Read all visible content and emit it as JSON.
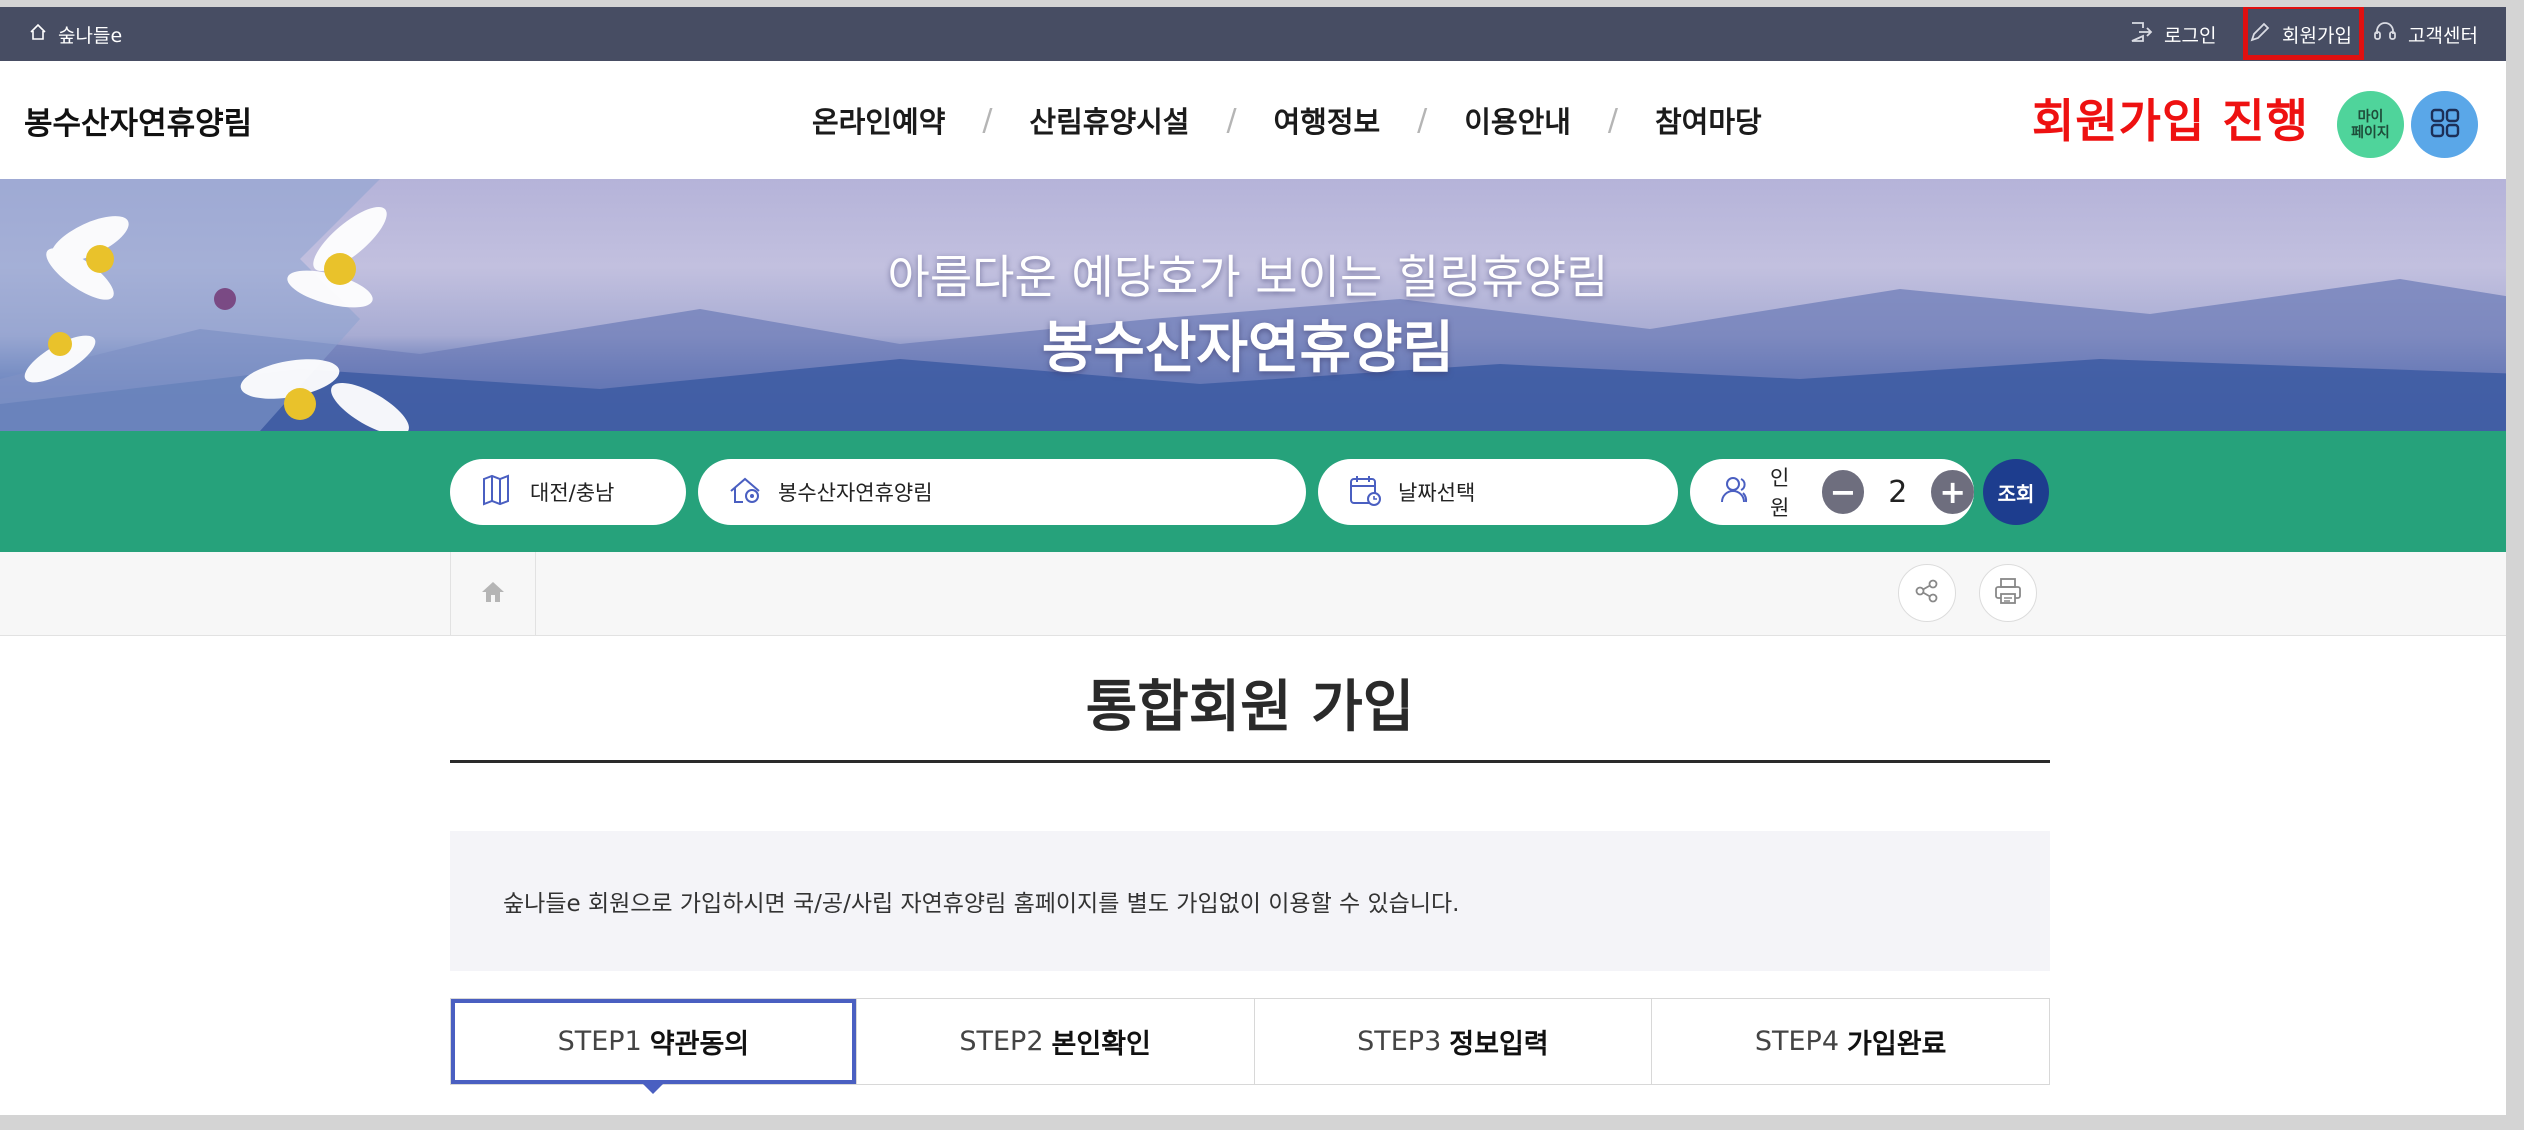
{
  "util": {
    "home_label": "숲나들e",
    "login_label": "로그인",
    "join_label": "회원가입",
    "cs_label": "고객센터"
  },
  "header": {
    "brand": "봉수산자연휴양림",
    "nav": [
      "온라인예약",
      "산림휴양시설",
      "여행정보",
      "이용안내",
      "참여마당"
    ],
    "nav_separator": "/",
    "join_caption": "회원가입 진행",
    "mypage_label_1": "마이",
    "mypage_label_2": "페이지"
  },
  "hero": {
    "title_line1": "아름다운 예당호가 보이는 힐링휴양림",
    "title_line2": "봉수산자연휴양림"
  },
  "search": {
    "region": "대전/충남",
    "forest": "봉수산자연휴양림",
    "date": "날짜선택",
    "people_label": "인원",
    "people_count": "2",
    "minus": "−",
    "plus": "+",
    "search_label": "조회"
  },
  "main": {
    "title": "통합회원 가입",
    "notice": "숲나들e 회원으로 가입하시면 국/공/사립 자연휴양림 홈페이지를 별도 가입없이 이용할 수 있습니다.",
    "steps": [
      {
        "num": "STEP1",
        "name": "약관동의"
      },
      {
        "num": "STEP2",
        "name": "본인확인"
      },
      {
        "num": "STEP3",
        "name": "정보입력"
      },
      {
        "num": "STEP4",
        "name": "가입완료"
      }
    ],
    "active_step": 1
  },
  "colors": {
    "util_bar": "#474d63",
    "search_bar": "#26a27b",
    "highlight": "#e01010",
    "active_step": "#4a5fc1"
  }
}
